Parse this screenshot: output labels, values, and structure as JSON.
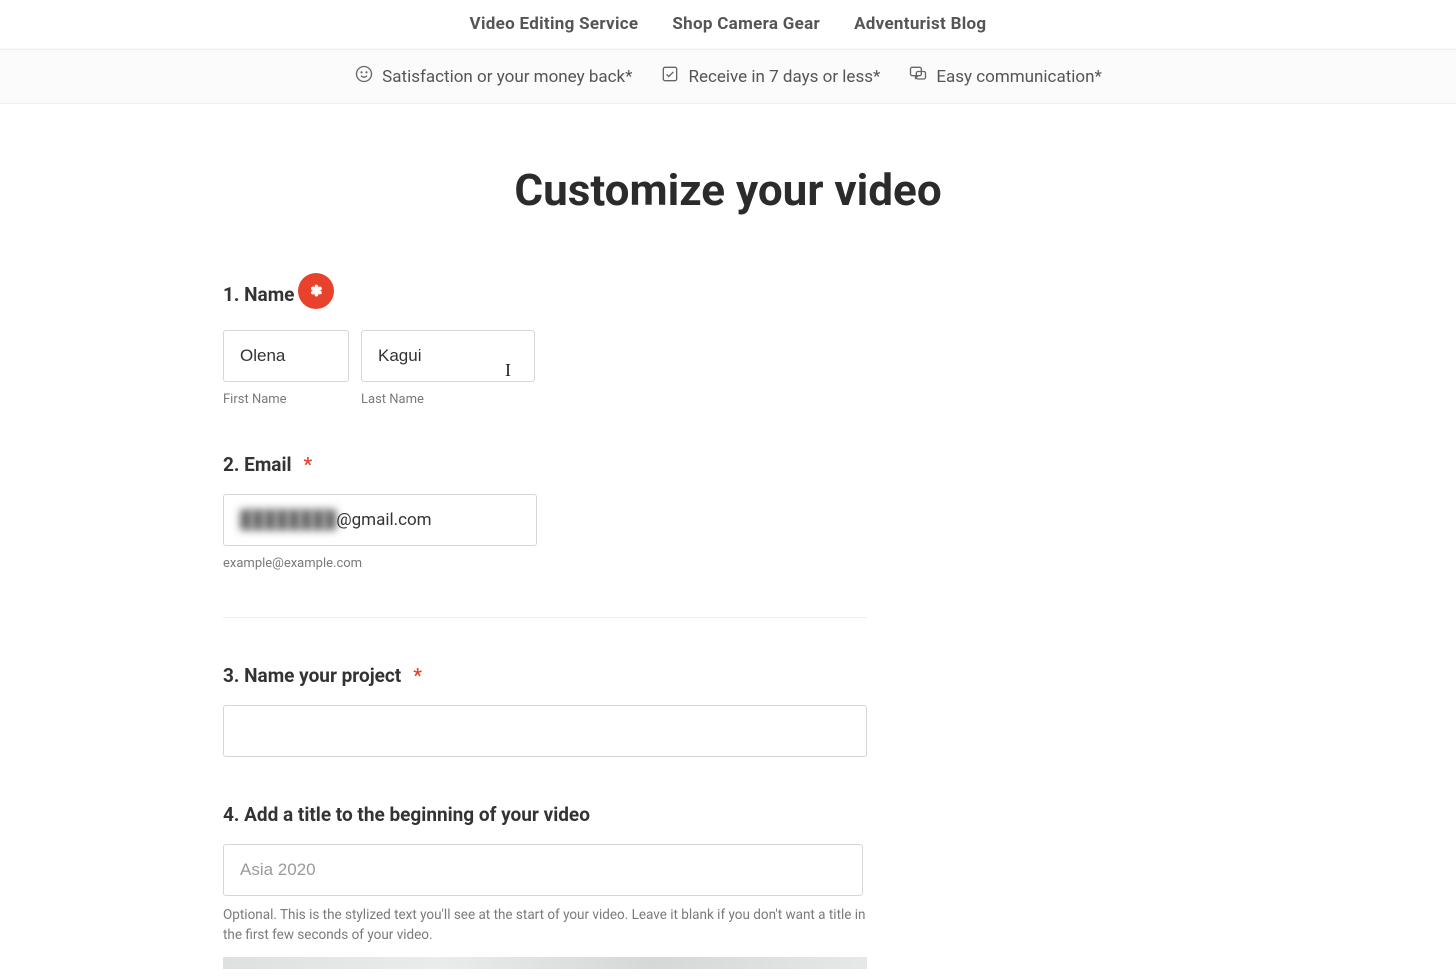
{
  "nav": {
    "items": [
      {
        "label": "Video Editing Service"
      },
      {
        "label": "Shop Camera Gear"
      },
      {
        "label": "Adventurist Blog"
      }
    ]
  },
  "benefits": {
    "items": [
      {
        "icon": "smile-icon",
        "text": "Satisfaction or your money back*"
      },
      {
        "icon": "check-icon",
        "text": "Receive in 7 days or less*"
      },
      {
        "icon": "chat-icon",
        "text": "Easy communication*"
      }
    ]
  },
  "page": {
    "title": "Customize your video"
  },
  "form": {
    "name": {
      "label": "1. Name",
      "required_badge": "✽",
      "first_value": "Olena",
      "last_value": "Kagui",
      "first_sub": "First Name",
      "last_sub": "Last Name"
    },
    "email": {
      "label": "2. Email",
      "value_local_blurred": "████████",
      "value_domain": "@gmail.com",
      "helper": "example@example.com"
    },
    "project": {
      "label": "3. Name your project",
      "value": ""
    },
    "title": {
      "label": "4. Add a title to the beginning of your video",
      "placeholder": "Asia 2020",
      "value": "",
      "helper": "Optional. This is the stylized text you'll see at the start of your video. Leave it blank if you don't want a title in the first few seconds of your video."
    }
  }
}
